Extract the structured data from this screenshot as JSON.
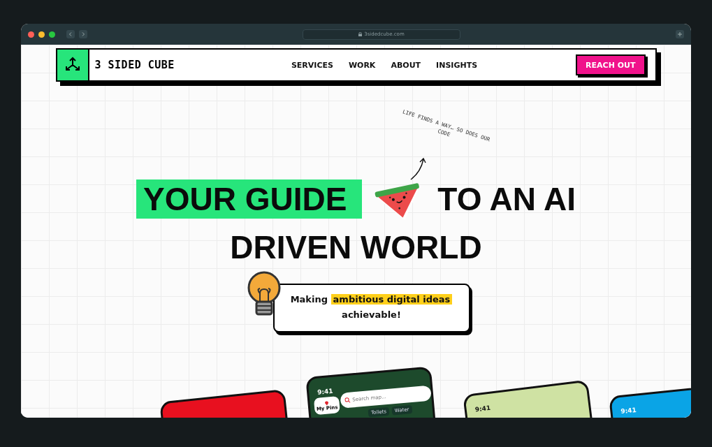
{
  "browser": {
    "url": "3sidedcube.com"
  },
  "nav": {
    "logo": "3 SIDED CUBE",
    "links": [
      {
        "label": "SERVICES"
      },
      {
        "label": "WORK"
      },
      {
        "label": "ABOUT"
      },
      {
        "label": "INSIGHTS"
      }
    ],
    "cta": "REACH OUT"
  },
  "note": {
    "text": "LIFE FINDS A WAY… SO DOES OUR CODE"
  },
  "headline": {
    "highlight": "YOUR GUIDE",
    "rest": "TO AN AI",
    "line2": "DRIVEN WORLD"
  },
  "tagline": {
    "before": "Making",
    "highlight": "ambitious digital ideas",
    "after": "achievable!"
  },
  "phones": [
    {
      "kind": "red"
    },
    {
      "kind": "map",
      "time": "9:41",
      "pins": "My Pins",
      "search": "Search map...",
      "chips": [
        "Toilets",
        "Water"
      ]
    },
    {
      "kind": "terrain",
      "time": "9:41"
    },
    {
      "kind": "blue",
      "time": "9:41"
    }
  ]
}
